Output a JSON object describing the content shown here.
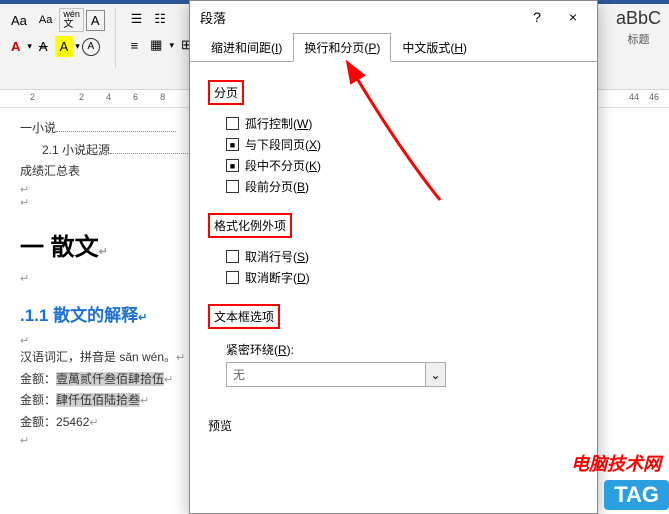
{
  "ribbon": {
    "font_btn1": "Aa",
    "font_btn2": "Aa",
    "pinyin": "wén",
    "pinyin_char": "文",
    "a_boxed": "A",
    "bold": "A",
    "strike": "A",
    "color_a": "A",
    "highlight_a": "A",
    "circled_a": "A",
    "style_preview": "aBbC",
    "style_label": "标题"
  },
  "ruler": {
    "marks": [
      "2",
      "",
      "2",
      "4",
      "6",
      "8"
    ],
    "right": [
      "44",
      "46"
    ]
  },
  "doc": {
    "line1_prefix": "一小说",
    "line2": "2.1 小说起源",
    "line3": "成绩汇总表",
    "heading1": "一 散文",
    "heading2": ".1.1 散文的解释",
    "para1": "汉语词汇，拼音是 sǎn wén。",
    "amount_label1": "金额：",
    "amount1": "壹萬贰仟叁佰肆拾伍",
    "amount_label2": "金额：",
    "amount2": "肆仟伍佰陆拾叁",
    "amount_label3": "金额：",
    "amount3": "25462",
    "mark": "↵"
  },
  "dialog": {
    "title": "段落",
    "help": "?",
    "close": "×",
    "tabs": {
      "indent": "缩进和间距(I)",
      "breaks": "换行和分页(P)",
      "chinese": "中文版式(H)"
    },
    "section_page": "分页",
    "chk_widow": "孤行控制(W)",
    "chk_keepnext": "与下段同页(X)",
    "chk_keeptogether": "段中不分页(K)",
    "chk_pagebreak": "段前分页(B)",
    "section_format": "格式化例外项",
    "chk_linenum": "取消行号(S)",
    "chk_hyphen": "取消断字(D)",
    "section_textbox": "文本框选项",
    "tight_wrap": "紧密环绕(R):",
    "select_none": "无",
    "preview": "预览"
  },
  "watermark1": "电脑技术网",
  "watermark2": "TAG"
}
